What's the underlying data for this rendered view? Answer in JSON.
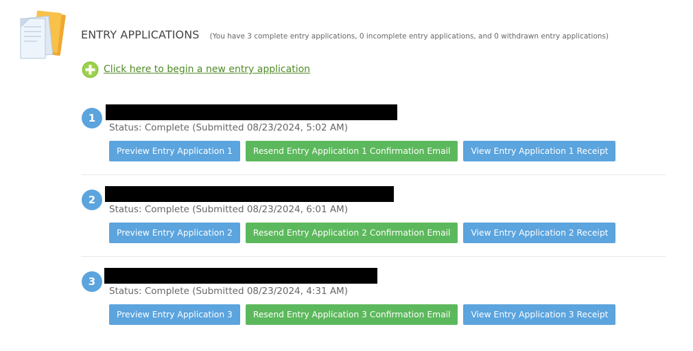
{
  "header": {
    "title": "ENTRY APPLICATIONS",
    "subtitle": "(You have 3 complete entry applications, 0 incomplete entry applications, and 0 withdrawn entry applications)"
  },
  "new_application_link": "Click here to begin a new entry application",
  "icons": {
    "folder": "documents-folder-icon",
    "add": "plus-circle-icon"
  },
  "colors": {
    "primary_blue": "#5ba4de",
    "success_green": "#5cb85c",
    "link_green": "#4f8a26"
  },
  "entries": [
    {
      "number": "1",
      "status": "Status: Complete (Submitted 08/23/2024, 5:02 AM)",
      "preview_label": "Preview Entry Application 1",
      "resend_label": "Resend Entry Application 1 Confirmation Email",
      "receipt_label": "View Entry Application 1 Receipt"
    },
    {
      "number": "2",
      "status": "Status: Complete (Submitted 08/23/2024, 6:01 AM)",
      "preview_label": "Preview Entry Application 2",
      "resend_label": "Resend Entry Application 2 Confirmation Email",
      "receipt_label": "View Entry Application 2 Receipt"
    },
    {
      "number": "3",
      "status": "Status: Complete (Submitted 08/23/2024, 4:31 AM)",
      "preview_label": "Preview Entry Application 3",
      "resend_label": "Resend Entry Application 3 Confirmation Email",
      "receipt_label": "View Entry Application 3 Receipt"
    }
  ]
}
